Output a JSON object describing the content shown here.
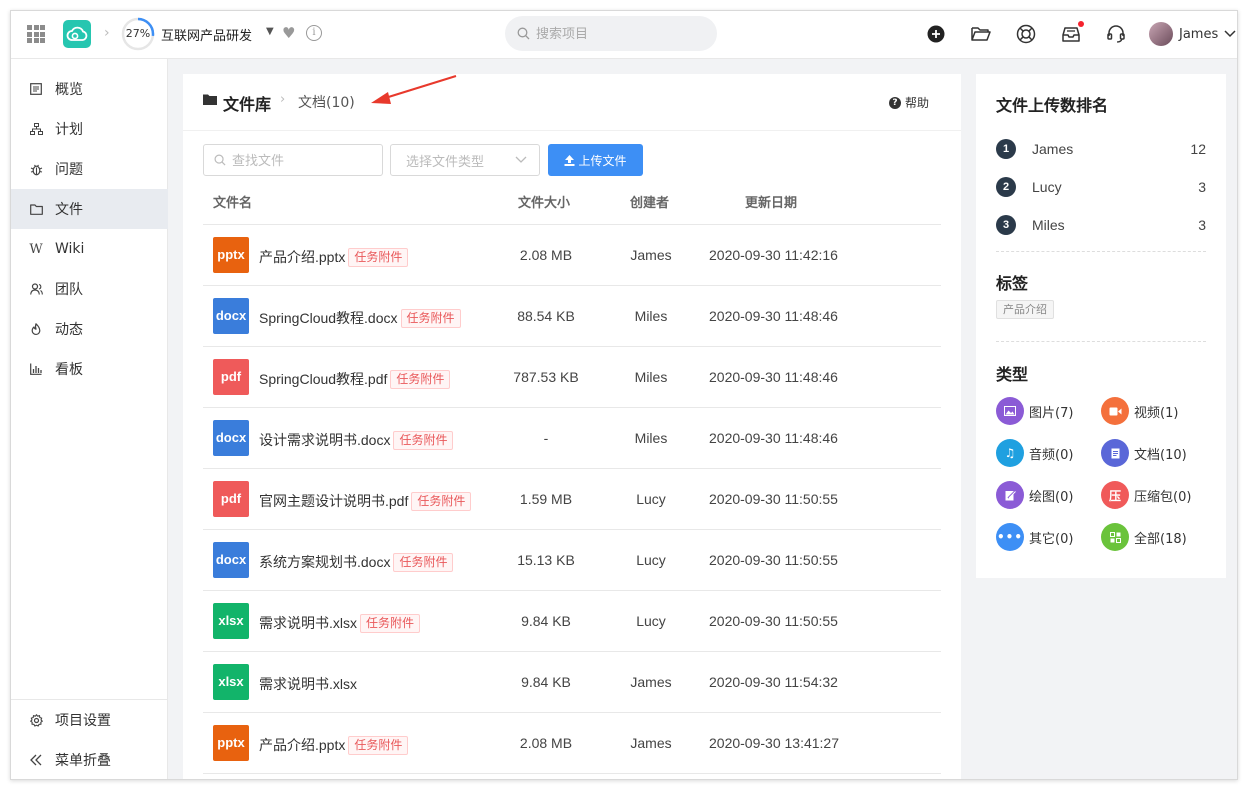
{
  "topbar": {
    "progress": "27%",
    "progress_value": 0.27,
    "project_name": "互联网产品研发",
    "search_placeholder": "搜索项目",
    "user_name": "James"
  },
  "sidebar": {
    "items": [
      {
        "label": "概览"
      },
      {
        "label": "计划"
      },
      {
        "label": "问题"
      },
      {
        "label": "文件"
      },
      {
        "label": "Wiki"
      },
      {
        "label": "团队"
      },
      {
        "label": "动态"
      },
      {
        "label": "看板"
      }
    ],
    "settings": "项目设置",
    "collapse": "菜单折叠"
  },
  "main": {
    "breadcrumb_root": "文件库",
    "breadcrumb_current": "文档(10)",
    "help": "帮助",
    "search_placeholder": "查找文件",
    "type_select_placeholder": "选择文件类型",
    "upload_label": "上传文件",
    "columns": {
      "name": "文件名",
      "size": "文件大小",
      "owner": "创建者",
      "date": "更新日期"
    },
    "task_tag": "任务附件",
    "files": [
      {
        "ext": "pptx",
        "color": "#e8620f",
        "name": "产品介绍.pptx",
        "tag": true,
        "size": "2.08 MB",
        "owner": "James",
        "date": "2020-09-30 11:42:16"
      },
      {
        "ext": "docx",
        "color": "#3a7ddb",
        "name": "SpringCloud教程.docx",
        "tag": true,
        "size": "88.54 KB",
        "owner": "Miles",
        "date": "2020-09-30 11:48:46"
      },
      {
        "ext": "pdf",
        "color": "#ef5a5a",
        "name": "SpringCloud教程.pdf",
        "tag": true,
        "size": "787.53 KB",
        "owner": "Miles",
        "date": "2020-09-30 11:48:46"
      },
      {
        "ext": "docx",
        "color": "#3a7ddb",
        "name": "设计需求说明书.docx",
        "tag": true,
        "size": "-",
        "owner": "Miles",
        "date": "2020-09-30 11:48:46"
      },
      {
        "ext": "pdf",
        "color": "#ef5a5a",
        "name": "官网主题设计说明书.pdf",
        "tag": true,
        "size": "1.59 MB",
        "owner": "Lucy",
        "date": "2020-09-30 11:50:55"
      },
      {
        "ext": "docx",
        "color": "#3a7ddb",
        "name": "系统方案规划书.docx",
        "tag": true,
        "size": "15.13 KB",
        "owner": "Lucy",
        "date": "2020-09-30 11:50:55"
      },
      {
        "ext": "xlsx",
        "color": "#12b46a",
        "name": "需求说明书.xlsx",
        "tag": true,
        "size": "9.84 KB",
        "owner": "Lucy",
        "date": "2020-09-30 11:50:55"
      },
      {
        "ext": "xlsx",
        "color": "#12b46a",
        "name": "需求说明书.xlsx",
        "tag": false,
        "size": "9.84 KB",
        "owner": "James",
        "date": "2020-09-30 11:54:32"
      },
      {
        "ext": "pptx",
        "color": "#e8620f",
        "name": "产品介绍.pptx",
        "tag": true,
        "size": "2.08 MB",
        "owner": "James",
        "date": "2020-09-30 13:41:27"
      }
    ]
  },
  "right": {
    "ranking_title": "文件上传数排名",
    "ranking": [
      {
        "num": "1",
        "name": "James",
        "count": "12"
      },
      {
        "num": "2",
        "name": "Lucy",
        "count": "3"
      },
      {
        "num": "3",
        "name": "Miles",
        "count": "3"
      }
    ],
    "tags_title": "标签",
    "tags": [
      "产品介绍"
    ],
    "types_title": "类型",
    "types": [
      {
        "label": "图片(7)",
        "color": "#8b5bd6",
        "icon": "image-icon"
      },
      {
        "label": "视频(1)",
        "color": "#f4703c",
        "icon": "video-icon"
      },
      {
        "label": "音频(0)",
        "color": "#1fa0e0",
        "icon": "music-icon"
      },
      {
        "label": "文档(10)",
        "color": "#5a67d8",
        "icon": "document-icon"
      },
      {
        "label": "绘图(0)",
        "color": "#8b5bd6",
        "icon": "drawing-icon"
      },
      {
        "label": "压缩包(0)",
        "color": "#f05a5a",
        "icon": "archive-icon"
      },
      {
        "label": "其它(0)",
        "color": "#3d8ff5",
        "icon": "more-icon"
      },
      {
        "label": "全部(18)",
        "color": "#6ac33b",
        "icon": "apps-icon"
      }
    ]
  }
}
